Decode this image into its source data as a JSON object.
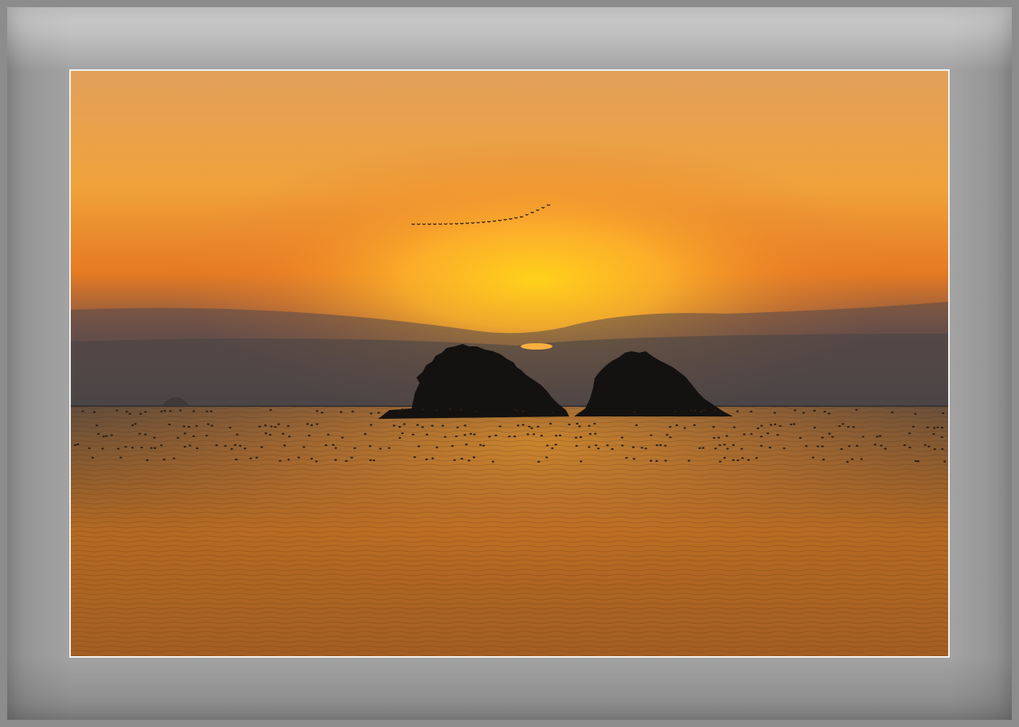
{
  "scene": {
    "description_hidden": "",
    "colors": {
      "sky_top": "#e2a05a",
      "sky_glow": "#ffcc2a",
      "sky_horizon": "#4c4848",
      "sea_far": "#5d4a38",
      "sea_near": "#c9721a",
      "island": "#141210",
      "frame": "#a3a3a3",
      "mat_border": "#f2f2f2"
    },
    "icons": [
      "bird-flock-icon",
      "sun-icon",
      "island-icon"
    ]
  }
}
